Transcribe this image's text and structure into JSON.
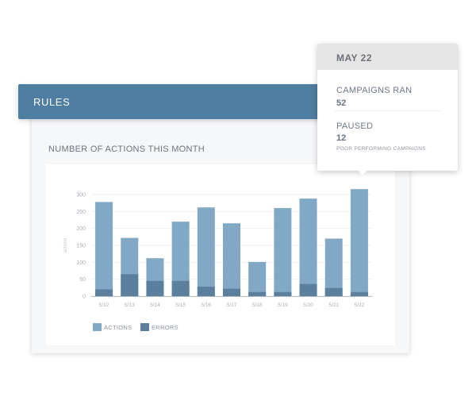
{
  "header": {
    "title": "RULES"
  },
  "section": {
    "title": "NUMBER OF ACTIONS THIS MONTH"
  },
  "tooltip": {
    "date": "MAY 22",
    "campaigns_label": "CAMPAIGNS RAN",
    "campaigns_value": "52",
    "paused_label": "PAUSED",
    "paused_value": "12",
    "paused_note": "POOR PERFORMING CAMPAIGNS"
  },
  "chart_data": {
    "type": "bar",
    "stacked": false,
    "categories": [
      "5/12",
      "5/13",
      "5/14",
      "5/15",
      "5/16",
      "5/17",
      "5/18",
      "5/19",
      "5/20",
      "5/21",
      "5/22"
    ],
    "series": [
      {
        "name": "ACTIONS",
        "values": [
          278,
          172,
          112,
          220,
          262,
          215,
          101,
          260,
          288,
          170,
          316
        ],
        "color": "#81a8c4"
      },
      {
        "name": "ERRORS",
        "values": [
          20,
          65,
          45,
          45,
          28,
          22,
          12,
          12,
          36,
          24,
          12
        ],
        "color": "#5b7f9c"
      }
    ],
    "ylabel": "actions",
    "ylim": [
      0,
      300
    ],
    "yticks": [
      0,
      50,
      100,
      150,
      200,
      250,
      300
    ],
    "grid": true,
    "legend": "bottom-left"
  }
}
